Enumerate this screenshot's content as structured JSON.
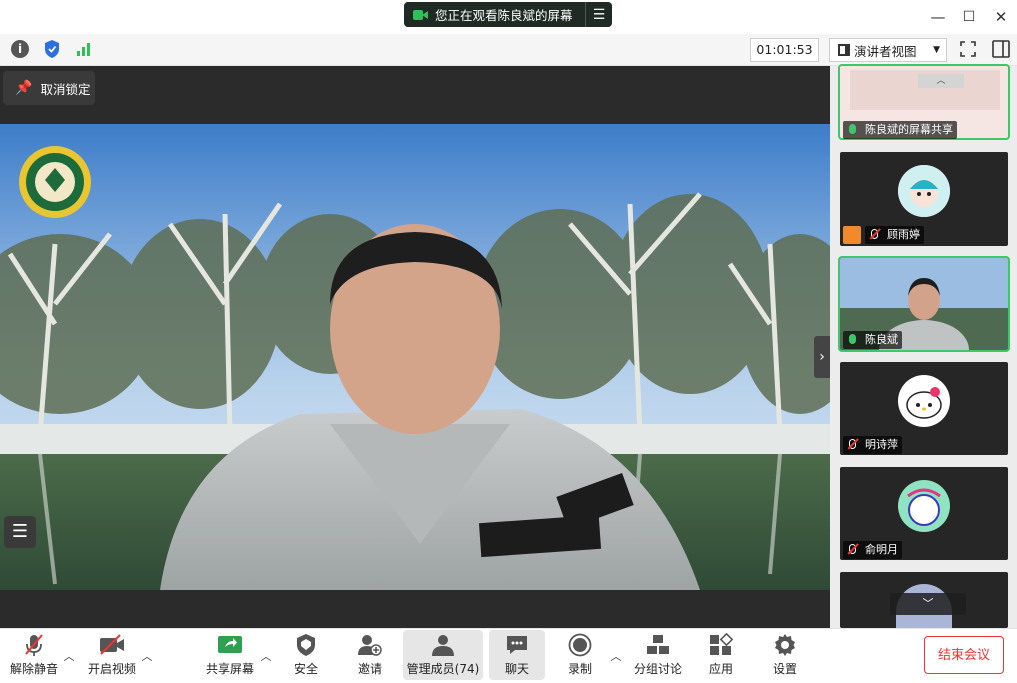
{
  "title_bar": {
    "share_status": "您正在观看陈良斌的屏幕"
  },
  "info_bar": {
    "timer": "01:01:53",
    "view_mode": "演讲者视图"
  },
  "stage": {
    "unpin_label": "取消锁定"
  },
  "participants": [
    {
      "name": "陈良斌的屏幕共享",
      "mic": "on"
    },
    {
      "name": "顾雨婷",
      "mic": "off"
    },
    {
      "name": "陈良斌",
      "mic": "on"
    },
    {
      "name": "明诗萍",
      "mic": "off"
    },
    {
      "name": "俞明月",
      "mic": "off"
    }
  ],
  "toolbar": {
    "unmute": "解除静音",
    "start_video": "开启视频",
    "share_screen": "共享屏幕",
    "security": "安全",
    "invite": "邀请",
    "manage_members": "管理成员(74)",
    "chat": "聊天",
    "record": "录制",
    "breakout": "分组讨论",
    "apps": "应用",
    "settings": "设置",
    "end_meeting": "结束会议"
  },
  "colors": {
    "accent_green": "#3cc76a",
    "end_red": "#e33333",
    "share_green": "#2fc05a"
  }
}
